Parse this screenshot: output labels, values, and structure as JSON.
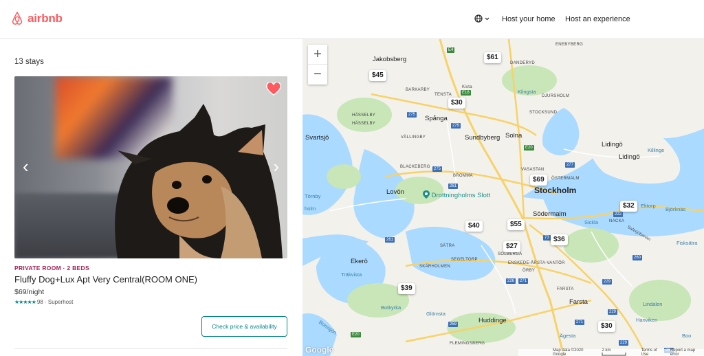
{
  "header": {
    "logo_text": "airbnb",
    "brand_color": "#ff5a5f",
    "language_icon": "globe-icon",
    "nav": [
      "Host your home",
      "Host an experience"
    ]
  },
  "listing_panel": {
    "count_text": "13 stays",
    "listing": {
      "type_label": "PRIVATE ROOM · 2 BEDS",
      "title": "Fluffy Dog+Lux Apt Very Central(ROOM ONE)",
      "price": "$69/night",
      "stars": "★★★★★",
      "rating_text": "98 · Superhost",
      "check_button": "Check price & availability",
      "favorite_icon": "heart-icon",
      "favorite_color": "#ff5a5f"
    }
  },
  "map": {
    "zoom_in": "+",
    "zoom_out": "−",
    "price_pins": [
      "$61",
      "$45",
      "$30",
      "$69",
      "$32",
      "$40",
      "$55",
      "$36",
      "$27",
      "$39",
      "$30"
    ],
    "labels": {
      "stockholm": "Stockholm",
      "solna": "Solna",
      "sundbyberg": "Sundbyberg",
      "spanga": "Spånga",
      "jakobsberg": "Jakobsberg",
      "kista": "Kista",
      "danderyd": "DANDERYD",
      "klingsta": "Klingsta",
      "djursholm": "DJURSHOLM",
      "stocksund": "STOCKSUND",
      "lidingo1": "Lidingö",
      "lidingo2": "Lidingö",
      "killinge": "Killinge",
      "svartsjo": "Svartsjö",
      "hasselby": "HÄSSELBY",
      "hasselby2": "HÄSSELBY",
      "vallingby": "VÄLLINGBY",
      "blackeberg": "BLACKEBERG",
      "bromma": "BROMMA",
      "lovon": "Lovön",
      "drottningholm": "Drottningholms Slott",
      "tornby": "Törnby",
      "holm": "holm",
      "vasastan": "VASASTAN",
      "ostermalm": "ÖSTERMALM",
      "sodermalm": "Södermalm",
      "sickla": "Sickla",
      "nacka": "NACKA",
      "ektorp": "Ektorp",
      "bjorknas": "Björknäs",
      "fisksatra": "Fisksätra",
      "satra": "SÄTRA",
      "ekero": "Ekerö",
      "skarholmen": "SKÄRHOLMEN",
      "segeltorp": "SEGELTORP",
      "solberga": "SOLBERGA",
      "trakvista": "Träkvista",
      "enskede": "ENSKEDE-ÅRSTA-VANTÖR",
      "orby": "ÖRBY",
      "farsta": "FARSTA",
      "farsta2": "Farsta",
      "botkyrka": "Botkyrka",
      "glomsta": "Glömsta",
      "huddinge": "Huddinge",
      "flemingsberg": "FLEMINGSBERG",
      "lindalen": "Lindalen",
      "hanviken": "Hanviken",
      "agesta": "Ägesta",
      "boo": "Boo",
      "barkarby": "BARKARBY",
      "tensta": "TENSTA",
      "enebyberg": "ENEBYBERG",
      "bornsjon": "Bornsjön",
      "saltsjobanan": "Saltsjöbanan"
    },
    "roads": [
      "E4",
      "E18",
      "275",
      "279",
      "275",
      "E20",
      "277",
      "261",
      "222",
      "73",
      "226",
      "271",
      "229",
      "229",
      "259",
      "E20",
      "271",
      "260",
      "261",
      "260",
      "229"
    ],
    "footer": {
      "google": "Google",
      "map_data": "Map data ©2020 Google",
      "scale": "2 km",
      "terms": "Terms of Use",
      "report": "Report a map error"
    },
    "colors": {
      "water": "#aadaff",
      "land": "#f2f1ec",
      "park": "#c8e6b7",
      "highway": "#f8d267"
    }
  }
}
